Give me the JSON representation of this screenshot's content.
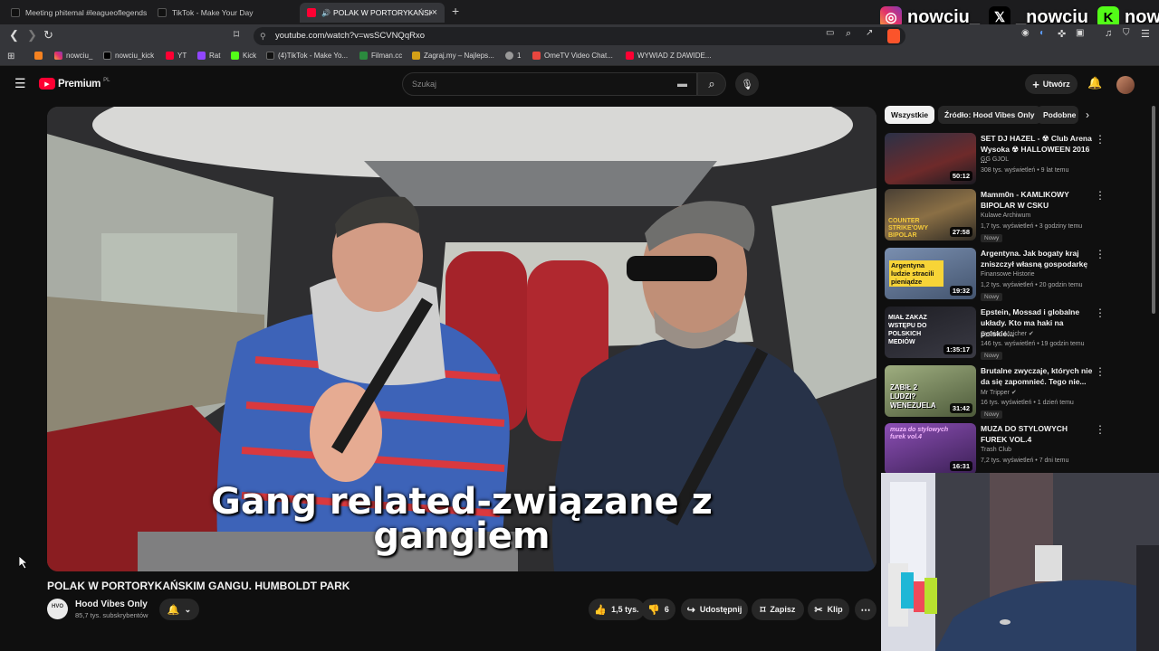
{
  "browser": {
    "tabs": [
      {
        "title": "Meeting phitemal #leagueoflegends",
        "icon": "tiktok-icon"
      },
      {
        "title": "TikTok - Make Your Day",
        "icon": "tiktok-icon"
      },
      {
        "title": "POLAK W PORTORYKAŃSKIM GANGU. HUMBOLDT PARK",
        "icon": "youtube-icon"
      }
    ],
    "new_tab": "+",
    "close_tab": "×",
    "url": "youtube.com/watch?v=wsSCVNQqRxo",
    "bookmarks": [
      {
        "label": "",
        "icon": "rss-icon"
      },
      {
        "label": "nowciu_",
        "icon": "instagram-icon"
      },
      {
        "label": "nowciu_kick",
        "icon": "x-icon"
      },
      {
        "label": "YT",
        "icon": "youtube-icon"
      },
      {
        "label": "Rat",
        "icon": "twitch-icon"
      },
      {
        "label": "Kick",
        "icon": "kick-icon"
      },
      {
        "label": "(4)TikTok - Make Yo...",
        "icon": "tiktok-icon"
      },
      {
        "label": "Filman.cc",
        "icon": "filman-icon"
      },
      {
        "label": "Zagraj.my – Najleps...",
        "icon": "game-icon"
      },
      {
        "label": "1",
        "icon": "globe-icon"
      },
      {
        "label": "OmeTV Video Chat...",
        "icon": "ome-icon"
      },
      {
        "label": "WYWIAD Z DAWIDE...",
        "icon": "youtube-icon"
      }
    ]
  },
  "socials": [
    {
      "icon": "instagram-icon",
      "handle": "nowciu_"
    },
    {
      "icon": "x-icon",
      "handle": "_nowciu"
    },
    {
      "icon": "kick-icon",
      "handle": "nowciu"
    }
  ],
  "youtube": {
    "logo": "Premium",
    "logo_region": "PL",
    "search_placeholder": "Szukaj",
    "create_label": "Utwórz"
  },
  "video": {
    "caption_line1": "Gang related-związane z",
    "caption_line2": "gangiem",
    "title": "POLAK W PORTORYKAŃSKIM GANGU. HUMBOLDT PARK",
    "channel": "Hood Vibes Only",
    "subscribers": "85,7 tys. subskrybentów",
    "likes": "1,5 tys.",
    "dislikes": "6",
    "share": "Udostępnij",
    "save": "Zapisz",
    "clip": "Klip"
  },
  "sidebar": {
    "chips": [
      "Wszystkie",
      "Źródło: Hood Vibes Only",
      "Podobne"
    ],
    "recommendations": [
      {
        "title": "SET DJ HAZEL - ☢ Club Arena Wysoka ☢ HALLOWEEN 2016 ...",
        "channel": "GG GJOL",
        "meta": "308 tys. wyświetleń • 9 lat temu",
        "duration": "50:12",
        "badge": "",
        "thumb_color": "#3a3f52"
      },
      {
        "title": "Mamm0n - KAMLIKOWY BIPOLAR W CSKU",
        "channel": "Kulawe Archiwum",
        "meta": "1,7 tys. wyświetleń • 3 godziny temu",
        "duration": "27:58",
        "badge": "Nowy",
        "thumb_color": "#6b5a3c"
      },
      {
        "title": "Argentyna. Jak bogaty kraj zniszczył własną gospodarkę",
        "channel": "Finansowe Historie",
        "meta": "1,2 tys. wyświetleń • 20 godzin temu",
        "duration": "19:32",
        "badge": "Nowy",
        "thumb_color": "#5a6d8a"
      },
      {
        "title": "Epstein, Mossad i globalne układy. Kto ma haki na polskie...",
        "channel": "Cyprian Majcher",
        "meta": "146 tys. wyświetleń • 19 godzin temu",
        "duration": "1:35:17",
        "badge": "Nowy",
        "thumb_color": "#2d2d34"
      },
      {
        "title": "Brutalne zwyczaje, których nie da się zapomnieć. Tego nie...",
        "channel": "Mr Tripper",
        "meta": "16 tys. wyświetleń • 1 dzień temu",
        "duration": "31:42",
        "badge": "Nowy",
        "thumb_color": "#7b8a5c"
      },
      {
        "title": "MUZA DO STYLOWYCH FUREK VOL.4",
        "channel": "Trash Club",
        "meta": "7,2 tys. wyświetleń • 7 dni temu",
        "duration": "16:31",
        "badge": "",
        "thumb_color": "#6a3e86"
      }
    ],
    "thumb_texts": [
      "",
      "COUNTER STRIKE'OWY BIPOLAR",
      "Argentyna ludzie stracili pieniądze",
      "MIAŁ ZAKAZ WSTĘPU DO POLSKICH MEDIÓW",
      "ZABIŁ 2 LUDZI? WENEZUELA",
      "muza do stylowych furek vol.4"
    ]
  }
}
